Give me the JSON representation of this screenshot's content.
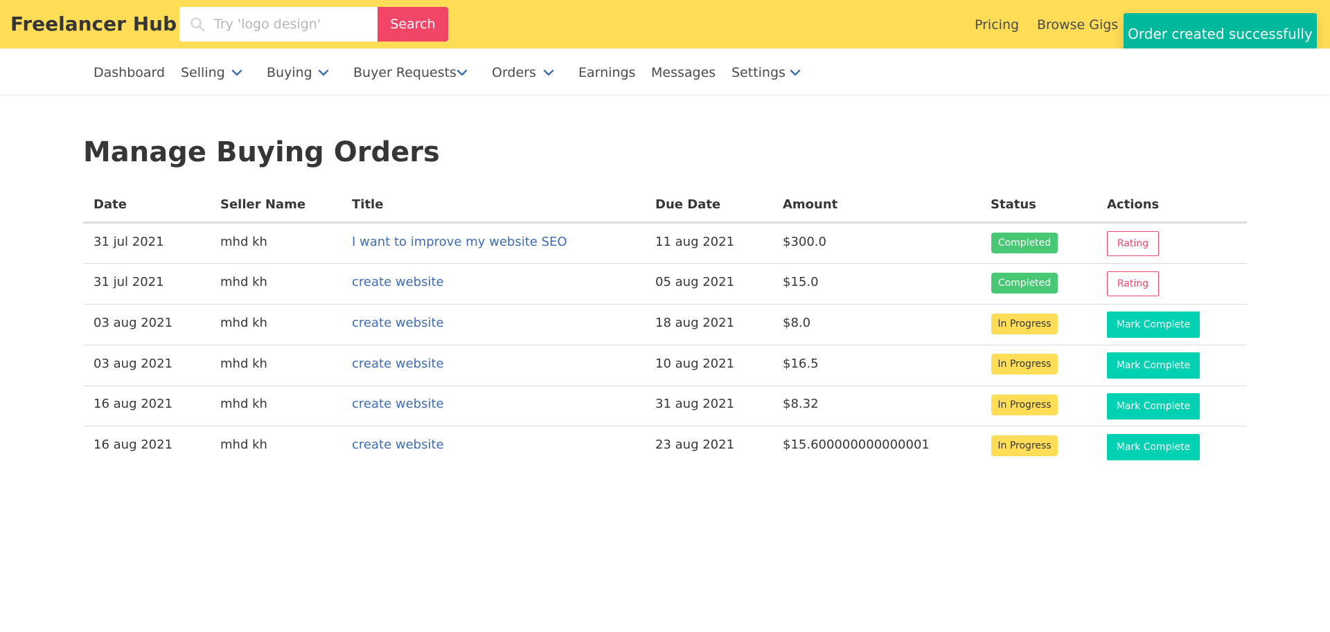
{
  "header": {
    "brand": "Freelancer Hub",
    "search_placeholder": "Try 'logo design'",
    "search_value": "",
    "search_button": "Search",
    "links": [
      "Pricing",
      "Browse Gigs"
    ],
    "bg_color": "#ffdd57"
  },
  "toast": {
    "message": "Order created successfully",
    "color": "#00b89c"
  },
  "nav": {
    "items": [
      {
        "label": "Dashboard",
        "dropdown": false
      },
      {
        "label": "Selling",
        "dropdown": true
      },
      {
        "label": "Buying",
        "dropdown": true
      },
      {
        "label": "Buyer Requests",
        "dropdown": true
      },
      {
        "label": "Orders",
        "dropdown": true
      },
      {
        "label": "Earnings",
        "dropdown": false
      },
      {
        "label": "Messages",
        "dropdown": false
      },
      {
        "label": "Settings",
        "dropdown": true
      }
    ],
    "chevron_color": "#3e6cb3"
  },
  "page": {
    "title": "Manage Buying Orders"
  },
  "table": {
    "columns": [
      "Date",
      "Seller Name",
      "Title",
      "Due Date",
      "Amount",
      "Status",
      "Actions"
    ],
    "rows": [
      {
        "date": "31 jul 2021",
        "seller": "mhd kh",
        "title": "I want to improve my website SEO",
        "due": "11 aug 2021",
        "amount": "$300.0",
        "status": "Completed",
        "action": "Rating"
      },
      {
        "date": "31 jul 2021",
        "seller": "mhd kh",
        "title": "create website",
        "due": "05 aug 2021",
        "amount": "$15.0",
        "status": "Completed",
        "action": "Rating"
      },
      {
        "date": "03 aug 2021",
        "seller": "mhd kh",
        "title": "create website",
        "due": "18 aug 2021",
        "amount": "$8.0",
        "status": "In Progress",
        "action": "Mark Complete"
      },
      {
        "date": "03 aug 2021",
        "seller": "mhd kh",
        "title": "create website",
        "due": "10 aug 2021",
        "amount": "$16.5",
        "status": "In Progress",
        "action": "Mark Complete"
      },
      {
        "date": "16 aug 2021",
        "seller": "mhd kh",
        "title": "create website",
        "due": "31 aug 2021",
        "amount": "$8.32",
        "status": "In Progress",
        "action": "Mark Complete"
      },
      {
        "date": "16 aug 2021",
        "seller": "mhd kh",
        "title": "create website",
        "due": "23 aug 2021",
        "amount": "$15.600000000000001",
        "status": "In Progress",
        "action": "Mark Complete"
      }
    ],
    "status_colors": {
      "Completed": "#48c774",
      "In Progress": "#ffdd57"
    },
    "link_color": "#3e6cb3"
  }
}
